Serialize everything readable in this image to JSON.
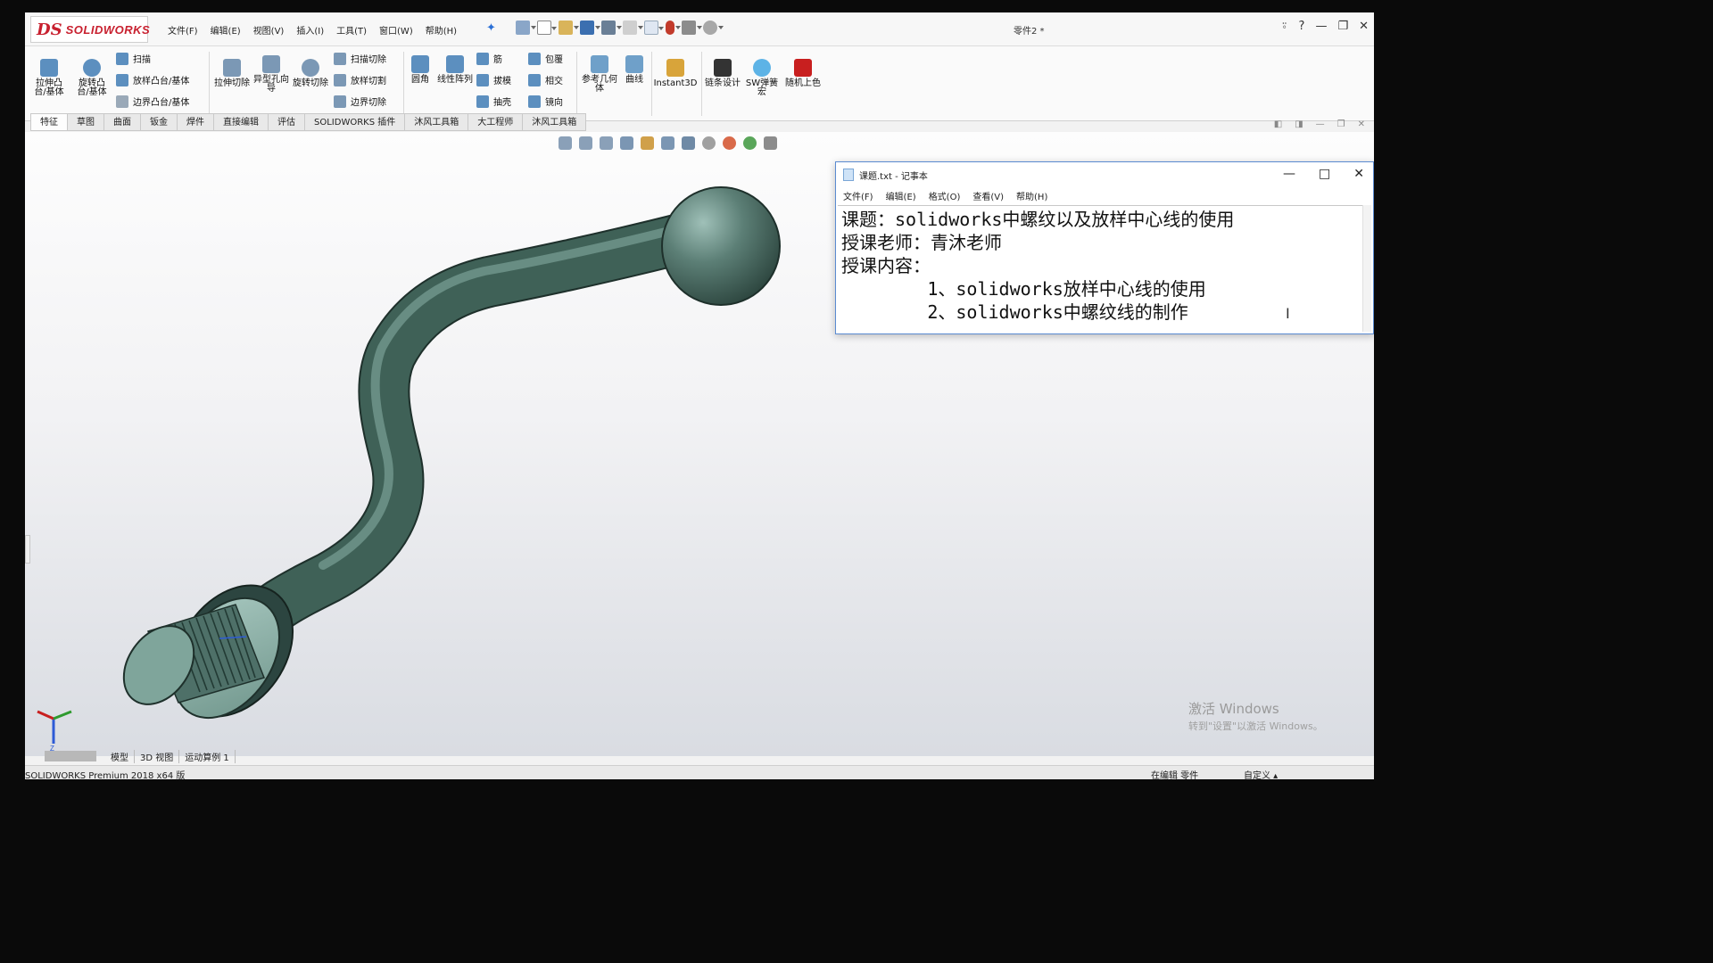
{
  "app": {
    "logo_ds": "DS",
    "logo_name": "SOLIDWORKS",
    "document_title": "零件2 *"
  },
  "menubar": [
    "文件(F)",
    "编辑(E)",
    "视图(V)",
    "插入(I)",
    "工具(T)",
    "窗口(W)",
    "帮助(H)"
  ],
  "window_controls": [
    "⍤",
    "?",
    "—",
    "❐",
    "✕"
  ],
  "features_toolbar": {
    "extrude_boss": "拉伸凸台/基体",
    "revolve_boss": "旋转凸台/基体",
    "sweep": "扫描",
    "loft_boss": "放样凸台/基体",
    "boundary_boss": "边界凸台/基体",
    "extrude_cut": "拉伸切除",
    "hole_wizard": "异型孔向导",
    "revolve_cut": "旋转切除",
    "swept_cut": "扫描切除",
    "lofted_cut": "放样切割",
    "boundary_cut": "边界切除",
    "fillet": "圆角",
    "linear_pattern": "线性阵列",
    "rib": "筋",
    "draft": "拔模",
    "shell": "抽壳",
    "wrap": "包覆",
    "intersect": "相交",
    "mirror": "镜向",
    "reference_geometry": "参考几何体",
    "curves": "曲线",
    "instant3d": "Instant3D",
    "chain_design": "链条设计",
    "spring_macro": "SW弹簧宏",
    "random_color": "随机上色"
  },
  "tabs": [
    "特征",
    "草图",
    "曲面",
    "钣金",
    "焊件",
    "直接编辑",
    "评估",
    "SOLIDWORKS 插件",
    "沐风工具箱",
    "大工程师",
    "沐风工具箱"
  ],
  "notepad": {
    "title": "课题.txt - 记事本",
    "menu": [
      "文件(F)",
      "编辑(E)",
      "格式(O)",
      "查看(V)",
      "帮助(H)"
    ],
    "lines": [
      "课题：solidworks中螺纹以及放样中心线的使用",
      "授课老师：青沐老师",
      "授课内容：",
      "        1、solidworks放样中心线的使用",
      "        2、solidworks中螺纹线的制作"
    ]
  },
  "bottom_tabs": [
    "模型",
    "3D 视图",
    "运动算例 1"
  ],
  "watermark": {
    "line1": "激活 Windows",
    "line2": "转到\"设置\"以激活 Windows。"
  },
  "status": {
    "product": "SOLIDWORKS Premium 2018 x64 版",
    "mode": "在编辑 零件",
    "units": "自定义"
  },
  "colors": {
    "part_body": "#3f6157",
    "part_face": "#7fa59b",
    "notepad_border": "#5b8bd1",
    "logo_red": "#c8202f"
  }
}
